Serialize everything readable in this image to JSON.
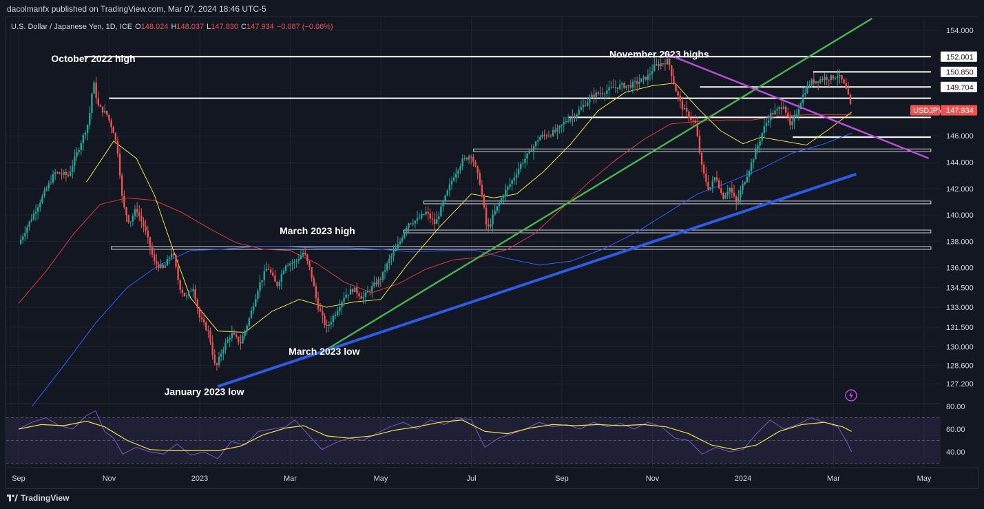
{
  "header": {
    "published_text": "dacolmanfx published on TradingView.com, Mar 07, 2024 18:46 UTC-5"
  },
  "footer": {
    "brand": "TradingView"
  },
  "colors": {
    "background": "#131722",
    "grid": "#1f2330",
    "text": "#d1d4dc",
    "up": "#26a69a",
    "down": "#ef5350",
    "ma_fast": "#f0e442",
    "ma_mid": "#e53935",
    "ma_slow": "#2962ff",
    "trend_green": "#4caf50",
    "trend_blue": "#2d5be3",
    "trend_purple": "#b84fd6",
    "rsi": "#7e57c2",
    "price_tag": "#ef5350"
  },
  "chart_data": {
    "type": "candlestick",
    "symbol_line": {
      "name": "U.S. Dollar / Japanese Yen, 1D, ICE",
      "o_label": "O",
      "o": "148.024",
      "h_label": "H",
      "h": "148.037",
      "l_label": "L",
      "l": "147.830",
      "c_label": "C",
      "c": "147.934",
      "change": "−0.087 (−0.06%)"
    },
    "last_price": {
      "symbol": "USDJPY",
      "value": 147.934,
      "label": "147.934"
    },
    "y_axis_ticks": [
      {
        "v": 154.0,
        "label": "154.000"
      },
      {
        "v": 146.0,
        "label": "146.000"
      },
      {
        "v": 144.0,
        "label": "144.000"
      },
      {
        "v": 142.0,
        "label": "142.000"
      },
      {
        "v": 140.0,
        "label": "140.000"
      },
      {
        "v": 138.0,
        "label": "138.000"
      },
      {
        "v": 136.0,
        "label": "136.000"
      },
      {
        "v": 134.5,
        "label": "134.500"
      },
      {
        "v": 133.0,
        "label": "133.000"
      },
      {
        "v": 131.5,
        "label": "131.500"
      },
      {
        "v": 130.0,
        "label": "130.000"
      },
      {
        "v": 128.6,
        "label": "128.600"
      },
      {
        "v": 127.2,
        "label": "127.200"
      }
    ],
    "level_tags": [
      {
        "v": 152.001,
        "label": "152.001"
      },
      {
        "v": 150.85,
        "label": "150.850"
      },
      {
        "v": 149.704,
        "label": "149.704"
      }
    ],
    "x_axis_labels": [
      {
        "month": 0,
        "label": "Sep"
      },
      {
        "month": 2,
        "label": "Nov"
      },
      {
        "month": 4,
        "label": "2023"
      },
      {
        "month": 6,
        "label": "Mar"
      },
      {
        "month": 8,
        "label": "May"
      },
      {
        "month": 10,
        "label": "Jul"
      },
      {
        "month": 12,
        "label": "Sep"
      },
      {
        "month": 14,
        "label": "Nov"
      },
      {
        "month": 16,
        "label": "2024"
      },
      {
        "month": 18,
        "label": "Mar"
      },
      {
        "month": 20,
        "label": "May"
      }
    ],
    "annotations": [
      {
        "text": "October 2022 high",
        "month": 1.65,
        "v": 151.6
      },
      {
        "text": "November 2023 highs",
        "month": 14.15,
        "v": 151.95
      },
      {
        "text": "March 2023 high",
        "month": 6.6,
        "v": 138.55
      },
      {
        "text": "March 2023 low",
        "month": 6.75,
        "v": 129.4
      },
      {
        "text": "January 2023 low",
        "month": 4.1,
        "v": 126.35
      }
    ],
    "horizontal_levels": [
      {
        "v": 152.001,
        "from": 1.45,
        "to": 20.15,
        "style": "white"
      },
      {
        "v": 150.85,
        "from": 17.55,
        "to": 20.15,
        "style": "white"
      },
      {
        "v": 149.704,
        "from": 15.05,
        "to": 20.15,
        "style": "white"
      },
      {
        "v": 148.85,
        "from": 2.0,
        "to": 20.15,
        "style": "white"
      },
      {
        "v": 147.4,
        "from": 12.15,
        "to": 20.15,
        "style": "white"
      },
      {
        "v": 145.9,
        "from": 17.1,
        "to": 20.15,
        "style": "white"
      },
      {
        "v": 144.9,
        "from": 10.05,
        "to": 20.15,
        "style": "band"
      },
      {
        "v": 140.95,
        "from": 8.95,
        "to": 20.15,
        "style": "band"
      },
      {
        "v": 138.75,
        "from": 8.5,
        "to": 20.15,
        "style": "band"
      },
      {
        "v": 137.5,
        "from": 2.05,
        "to": 20.15,
        "style": "band"
      }
    ],
    "trendlines": [
      {
        "color": "green",
        "x1": 6.85,
        "y1": 129.9,
        "x2": 18.85,
        "y2": 154.9
      },
      {
        "color": "blue",
        "x1": 4.4,
        "y1": 127.0,
        "x2": 18.5,
        "y2": 143.1
      },
      {
        "color": "purple",
        "x1": 14.25,
        "y1": 152.3,
        "x2": 20.1,
        "y2": 144.3
      }
    ],
    "price_path": [
      [
        0.0,
        137.8
      ],
      [
        0.2,
        139.2
      ],
      [
        0.5,
        141.2
      ],
      [
        0.8,
        143.2
      ],
      [
        1.1,
        143.0
      ],
      [
        1.3,
        144.8
      ],
      [
        1.55,
        147.1
      ],
      [
        1.65,
        150.2
      ],
      [
        1.75,
        148.3
      ],
      [
        1.95,
        147.6
      ],
      [
        2.1,
        146.3
      ],
      [
        2.2,
        144.6
      ],
      [
        2.3,
        140.8
      ],
      [
        2.45,
        139.4
      ],
      [
        2.6,
        140.5
      ],
      [
        2.8,
        138.8
      ],
      [
        3.0,
        136.4
      ],
      [
        3.2,
        135.9
      ],
      [
        3.4,
        137.3
      ],
      [
        3.55,
        134.6
      ],
      [
        3.7,
        133.7
      ],
      [
        3.85,
        134.6
      ],
      [
        4.0,
        132.2
      ],
      [
        4.2,
        131.1
      ],
      [
        4.35,
        128.3
      ],
      [
        4.5,
        129.8
      ],
      [
        4.7,
        131.0
      ],
      [
        4.9,
        130.3
      ],
      [
        5.1,
        132.2
      ],
      [
        5.3,
        134.6
      ],
      [
        5.5,
        136.1
      ],
      [
        5.7,
        134.6
      ],
      [
        5.9,
        136.3
      ],
      [
        6.1,
        136.4
      ],
      [
        6.3,
        137.2
      ],
      [
        6.45,
        135.7
      ],
      [
        6.6,
        133.2
      ],
      [
        6.8,
        131.4
      ],
      [
        7.0,
        132.6
      ],
      [
        7.2,
        133.9
      ],
      [
        7.4,
        134.4
      ],
      [
        7.6,
        133.7
      ],
      [
        7.8,
        134.5
      ],
      [
        8.0,
        135.2
      ],
      [
        8.2,
        136.7
      ],
      [
        8.4,
        137.8
      ],
      [
        8.6,
        139.4
      ],
      [
        8.8,
        139.6
      ],
      [
        9.0,
        140.2
      ],
      [
        9.2,
        139.3
      ],
      [
        9.4,
        141.1
      ],
      [
        9.6,
        142.9
      ],
      [
        9.8,
        144.1
      ],
      [
        10.0,
        144.6
      ],
      [
        10.2,
        142.3
      ],
      [
        10.35,
        138.8
      ],
      [
        10.5,
        140.1
      ],
      [
        10.7,
        141.5
      ],
      [
        10.9,
        142.6
      ],
      [
        11.1,
        143.9
      ],
      [
        11.3,
        144.8
      ],
      [
        11.5,
        145.9
      ],
      [
        11.7,
        146.1
      ],
      [
        11.9,
        146.4
      ],
      [
        12.1,
        147.2
      ],
      [
        12.3,
        147.6
      ],
      [
        12.5,
        148.4
      ],
      [
        12.7,
        149.1
      ],
      [
        12.9,
        149.3
      ],
      [
        13.1,
        149.6
      ],
      [
        13.3,
        149.8
      ],
      [
        13.5,
        149.8
      ],
      [
        13.7,
        150.1
      ],
      [
        13.9,
        150.5
      ],
      [
        14.05,
        151.3
      ],
      [
        14.2,
        151.5
      ],
      [
        14.35,
        151.7
      ],
      [
        14.5,
        149.6
      ],
      [
        14.65,
        148.2
      ],
      [
        14.8,
        147.5
      ],
      [
        14.95,
        146.9
      ],
      [
        15.1,
        143.4
      ],
      [
        15.25,
        141.9
      ],
      [
        15.4,
        143.0
      ],
      [
        15.55,
        141.3
      ],
      [
        15.7,
        142.1
      ],
      [
        15.85,
        140.9
      ],
      [
        16.0,
        142.3
      ],
      [
        16.15,
        143.6
      ],
      [
        16.3,
        145.0
      ],
      [
        16.45,
        146.5
      ],
      [
        16.6,
        147.6
      ],
      [
        16.75,
        147.9
      ],
      [
        16.9,
        148.4
      ],
      [
        17.05,
        146.6
      ],
      [
        17.2,
        147.9
      ],
      [
        17.35,
        149.3
      ],
      [
        17.5,
        150.1
      ],
      [
        17.65,
        150.2
      ],
      [
        17.8,
        150.4
      ],
      [
        17.95,
        150.4
      ],
      [
        18.1,
        150.6
      ],
      [
        18.2,
        150.1
      ],
      [
        18.3,
        149.3
      ],
      [
        18.4,
        147.93
      ]
    ],
    "ma_fast": [
      [
        1.5,
        142.5
      ],
      [
        2.1,
        145.6
      ],
      [
        2.6,
        144.3
      ],
      [
        3.0,
        141.5
      ],
      [
        3.4,
        137.5
      ],
      [
        3.8,
        133.7
      ],
      [
        4.4,
        131.2
      ],
      [
        5.0,
        131.1
      ],
      [
        5.6,
        132.7
      ],
      [
        6.2,
        133.6
      ],
      [
        6.8,
        133.0
      ],
      [
        7.4,
        133.4
      ],
      [
        8.0,
        133.6
      ],
      [
        8.6,
        136.3
      ],
      [
        9.3,
        139.1
      ],
      [
        10.0,
        141.6
      ],
      [
        10.5,
        141.3
      ],
      [
        11.0,
        141.6
      ],
      [
        11.6,
        143.3
      ],
      [
        12.2,
        145.4
      ],
      [
        12.8,
        147.9
      ],
      [
        13.4,
        149.3
      ],
      [
        14.0,
        149.8
      ],
      [
        14.5,
        150.0
      ],
      [
        15.0,
        148.1
      ],
      [
        15.5,
        146.4
      ],
      [
        16.0,
        145.4
      ],
      [
        16.4,
        145.9
      ],
      [
        16.9,
        145.6
      ],
      [
        17.4,
        145.3
      ],
      [
        17.9,
        146.5
      ],
      [
        18.4,
        147.8
      ]
    ],
    "ma_mid": [
      [
        0.0,
        133.3
      ],
      [
        0.6,
        135.7
      ],
      [
        1.2,
        138.5
      ],
      [
        1.8,
        140.8
      ],
      [
        2.4,
        141.3
      ],
      [
        3.0,
        141.1
      ],
      [
        3.6,
        140.2
      ],
      [
        4.2,
        139.0
      ],
      [
        4.8,
        137.9
      ],
      [
        5.4,
        137.4
      ],
      [
        6.0,
        137.3
      ],
      [
        6.6,
        136.3
      ],
      [
        7.2,
        134.9
      ],
      [
        7.8,
        134.1
      ],
      [
        8.4,
        134.8
      ],
      [
        9.0,
        135.9
      ],
      [
        9.6,
        136.6
      ],
      [
        10.2,
        136.8
      ],
      [
        10.8,
        137.4
      ],
      [
        11.4,
        138.6
      ],
      [
        12.0,
        140.5
      ],
      [
        12.6,
        142.5
      ],
      [
        13.2,
        144.2
      ],
      [
        13.8,
        145.7
      ],
      [
        14.4,
        146.9
      ],
      [
        15.0,
        147.1
      ],
      [
        15.6,
        147.2
      ],
      [
        16.2,
        147.2
      ],
      [
        16.8,
        147.5
      ],
      [
        17.4,
        147.6
      ],
      [
        18.4,
        147.6
      ]
    ],
    "ma_slow": [
      [
        0.3,
        125.5
      ],
      [
        1.0,
        128.6
      ],
      [
        1.7,
        131.8
      ],
      [
        2.4,
        134.5
      ],
      [
        3.1,
        136.2
      ],
      [
        3.8,
        137.3
      ],
      [
        4.5,
        137.4
      ],
      [
        5.2,
        137.6
      ],
      [
        5.9,
        137.6
      ],
      [
        6.6,
        137.5
      ],
      [
        7.3,
        137.5
      ],
      [
        8.0,
        137.4
      ],
      [
        8.7,
        137.2
      ],
      [
        9.4,
        137.3
      ],
      [
        10.1,
        137.3
      ],
      [
        10.8,
        136.7
      ],
      [
        11.5,
        136.2
      ],
      [
        12.2,
        136.5
      ],
      [
        12.9,
        137.4
      ],
      [
        13.6,
        138.6
      ],
      [
        14.3,
        140.1
      ],
      [
        15.0,
        141.6
      ],
      [
        15.7,
        142.5
      ],
      [
        16.4,
        143.5
      ],
      [
        17.1,
        144.7
      ],
      [
        17.8,
        145.4
      ],
      [
        18.4,
        146.2
      ]
    ],
    "rsi": {
      "ticks": [
        {
          "v": 80,
          "label": "80.00"
        },
        {
          "v": 60,
          "label": "60.00"
        },
        {
          "v": 40,
          "label": "40.00"
        }
      ],
      "upper": 70,
      "lower": 30,
      "mid": 50,
      "values": [
        [
          0.0,
          60
        ],
        [
          0.3,
          66
        ],
        [
          0.6,
          70
        ],
        [
          0.9,
          63
        ],
        [
          1.2,
          60
        ],
        [
          1.5,
          72
        ],
        [
          1.7,
          76
        ],
        [
          1.9,
          58
        ],
        [
          2.1,
          52
        ],
        [
          2.3,
          38
        ],
        [
          2.6,
          44
        ],
        [
          2.9,
          40
        ],
        [
          3.2,
          38
        ],
        [
          3.5,
          47
        ],
        [
          3.8,
          37
        ],
        [
          4.1,
          40
        ],
        [
          4.4,
          34
        ],
        [
          4.7,
          49
        ],
        [
          5.0,
          46
        ],
        [
          5.3,
          58
        ],
        [
          5.6,
          60
        ],
        [
          5.9,
          62
        ],
        [
          6.1,
          68
        ],
        [
          6.4,
          55
        ],
        [
          6.7,
          42
        ],
        [
          7.0,
          48
        ],
        [
          7.3,
          52
        ],
        [
          7.6,
          50
        ],
        [
          7.9,
          56
        ],
        [
          8.2,
          62
        ],
        [
          8.5,
          66
        ],
        [
          8.8,
          60
        ],
        [
          9.1,
          68
        ],
        [
          9.4,
          64
        ],
        [
          9.7,
          70
        ],
        [
          10.0,
          68
        ],
        [
          10.3,
          44
        ],
        [
          10.6,
          52
        ],
        [
          10.9,
          56
        ],
        [
          11.2,
          60
        ],
        [
          11.5,
          66
        ],
        [
          11.8,
          62
        ],
        [
          12.1,
          64
        ],
        [
          12.4,
          60
        ],
        [
          12.7,
          66
        ],
        [
          13.0,
          62
        ],
        [
          13.3,
          65
        ],
        [
          13.6,
          60
        ],
        [
          13.9,
          66
        ],
        [
          14.2,
          62
        ],
        [
          14.5,
          52
        ],
        [
          14.8,
          50
        ],
        [
          15.1,
          38
        ],
        [
          15.4,
          44
        ],
        [
          15.7,
          40
        ],
        [
          16.0,
          42
        ],
        [
          16.3,
          56
        ],
        [
          16.6,
          68
        ],
        [
          16.9,
          60
        ],
        [
          17.2,
          64
        ],
        [
          17.5,
          70
        ],
        [
          17.8,
          66
        ],
        [
          18.1,
          62
        ],
        [
          18.3,
          48
        ],
        [
          18.4,
          40
        ]
      ],
      "ma": [
        [
          0.0,
          60
        ],
        [
          0.5,
          64
        ],
        [
          1.0,
          63
        ],
        [
          1.5,
          67
        ],
        [
          1.9,
          62
        ],
        [
          2.4,
          50
        ],
        [
          2.9,
          42
        ],
        [
          3.4,
          41
        ],
        [
          3.9,
          41
        ],
        [
          4.4,
          41
        ],
        [
          4.9,
          45
        ],
        [
          5.4,
          55
        ],
        [
          5.9,
          61
        ],
        [
          6.3,
          63
        ],
        [
          6.8,
          54
        ],
        [
          7.3,
          52
        ],
        [
          7.8,
          54
        ],
        [
          8.3,
          59
        ],
        [
          8.8,
          62
        ],
        [
          9.3,
          66
        ],
        [
          9.8,
          68
        ],
        [
          10.3,
          58
        ],
        [
          10.8,
          56
        ],
        [
          11.3,
          61
        ],
        [
          11.8,
          64
        ],
        [
          12.3,
          63
        ],
        [
          12.8,
          64
        ],
        [
          13.3,
          63
        ],
        [
          13.8,
          64
        ],
        [
          14.3,
          62
        ],
        [
          14.8,
          56
        ],
        [
          15.3,
          46
        ],
        [
          15.8,
          42
        ],
        [
          16.3,
          46
        ],
        [
          16.8,
          58
        ],
        [
          17.3,
          64
        ],
        [
          17.8,
          66
        ],
        [
          18.2,
          62
        ],
        [
          18.4,
          58
        ]
      ]
    }
  }
}
